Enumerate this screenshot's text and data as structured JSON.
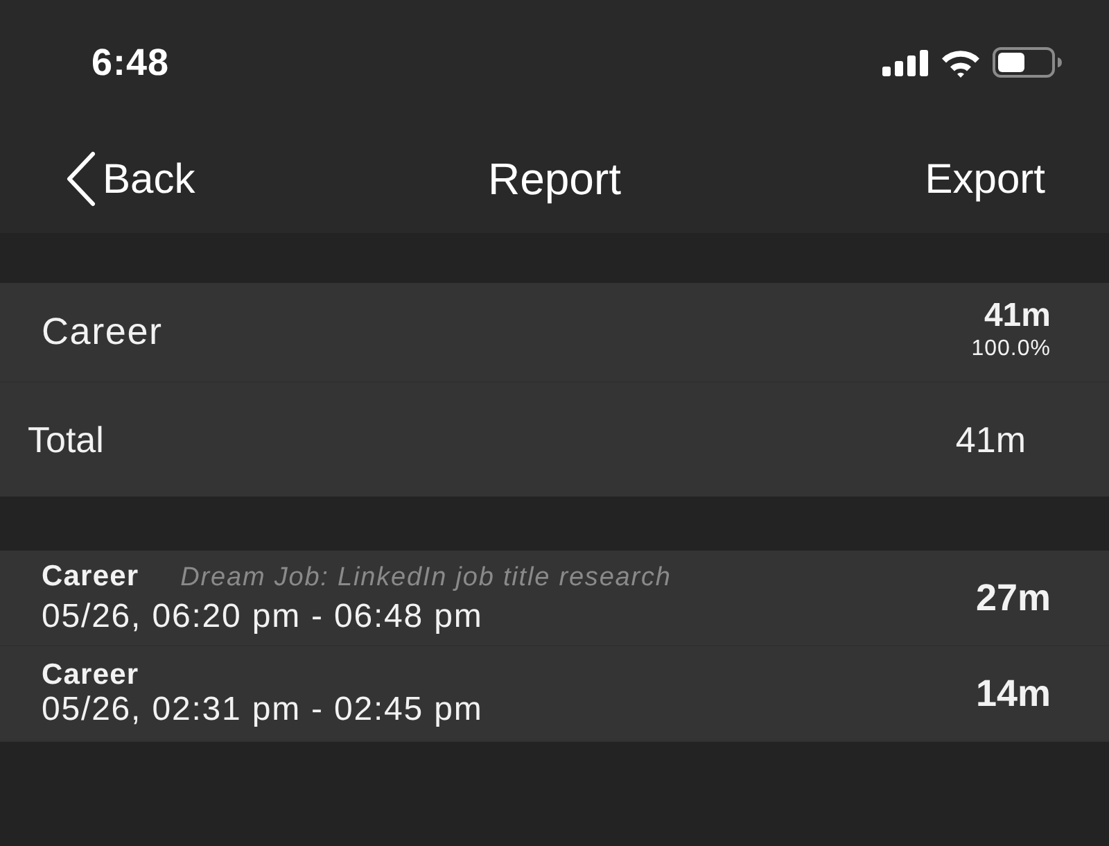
{
  "status_bar": {
    "time": "6:48"
  },
  "nav": {
    "back": "Back",
    "title": "Report",
    "action": "Export"
  },
  "summary": {
    "categories": [
      {
        "name": "Career",
        "duration": "41m",
        "percent": "100.0%"
      }
    ],
    "total": {
      "label": "Total",
      "duration": "41m"
    }
  },
  "sessions": [
    {
      "category": "Career",
      "note": "Dream Job: LinkedIn job title research",
      "time_range": "05/26, 06:20 pm - 06:48 pm",
      "duration": "27m"
    },
    {
      "category": "Career",
      "time_range": "05/26, 02:31 pm - 02:45 pm",
      "duration": "14m"
    }
  ]
}
